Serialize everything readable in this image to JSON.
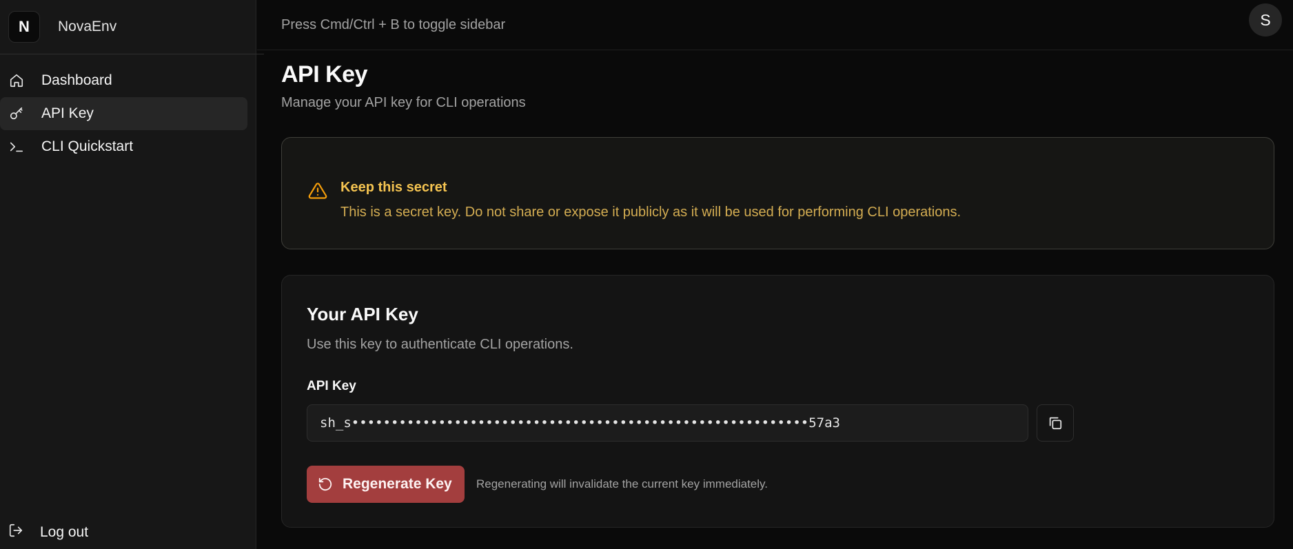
{
  "brand": {
    "logo_letter": "N",
    "name": "NovaEnv"
  },
  "sidebar": {
    "items": [
      {
        "label": "Dashboard",
        "icon": "home-icon",
        "active": false
      },
      {
        "label": "API Key",
        "icon": "key-icon",
        "active": true
      },
      {
        "label": "CLI Quickstart",
        "icon": "terminal-icon",
        "active": false
      }
    ],
    "logout_label": "Log out"
  },
  "topbar": {
    "hint": "Press Cmd/Ctrl + B to toggle sidebar",
    "avatar_letter": "S"
  },
  "page": {
    "title": "API Key",
    "subtitle": "Manage your API key for CLI operations"
  },
  "alert": {
    "icon": "warning-icon",
    "title": "Keep this secret",
    "description": "This is a secret key. Do not share or expose it publicly as it will be used for performing CLI operations."
  },
  "key_card": {
    "title": "Your API Key",
    "description": "Use this key to authenticate CLI operations.",
    "field_label": "API Key",
    "masked_value": "sh_s••••••••••••••••••••••••••••••••••••••••••••••••••••••••••57a3",
    "copy_icon": "copy-icon",
    "regenerate_label": "Regenerate Key",
    "regenerate_icon": "rotate-ccw-icon",
    "regenerate_note": "Regenerating will invalidate the current key immediately."
  },
  "colors": {
    "accent_danger": "#a33e3e",
    "warning_title": "#f5c451",
    "warning_text": "#d4ad52",
    "active_nav_bg": "#262626"
  }
}
